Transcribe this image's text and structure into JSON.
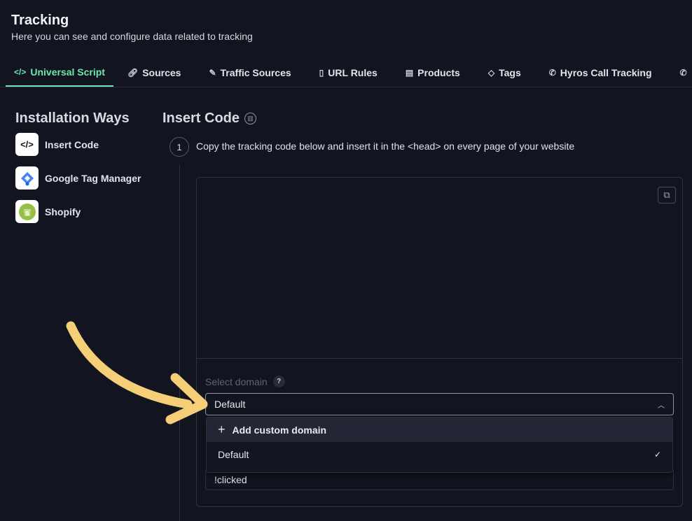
{
  "header": {
    "title": "Tracking",
    "subtitle": "Here you can see and configure data related to tracking"
  },
  "tabs": [
    {
      "label": "Universal Script",
      "icon": "code-icon",
      "active": true
    },
    {
      "label": "Sources",
      "icon": "link-icon"
    },
    {
      "label": "Traffic Sources",
      "icon": "edit-icon"
    },
    {
      "label": "URL Rules",
      "icon": "document-cursor-icon"
    },
    {
      "label": "Products",
      "icon": "box-icon"
    },
    {
      "label": "Tags",
      "icon": "tag-icon"
    },
    {
      "label": "Hyros Call Tracking",
      "icon": "phone-incoming-icon"
    },
    {
      "label": "",
      "icon": "phone-incoming-icon"
    }
  ],
  "sidebar": {
    "title": "Installation Ways",
    "items": [
      {
        "label": "Insert Code"
      },
      {
        "label": "Google Tag Manager"
      },
      {
        "label": "Shopify"
      }
    ]
  },
  "main": {
    "title": "Insert Code",
    "step_number": "1",
    "step_text": "Copy the tracking code below and insert it in the <head> on every page of your website",
    "domain_label": "Select domain",
    "help": "?",
    "selected": "Default",
    "options": [
      {
        "label": "Add custom domain"
      },
      {
        "label": "Default",
        "selected": true
      }
    ],
    "input_value": "!clicked"
  },
  "colors": {
    "accent": "#6ee7b0",
    "background": "#12141f",
    "arrow": "#f5cf77"
  }
}
